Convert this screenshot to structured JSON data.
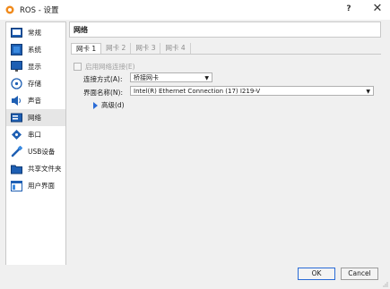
{
  "window": {
    "title": "ROS - 设置",
    "help_label": "?",
    "close_label": "✕"
  },
  "sidebar": {
    "items": [
      {
        "label": "常规",
        "icon": "general-icon"
      },
      {
        "label": "系统",
        "icon": "system-icon"
      },
      {
        "label": "显示",
        "icon": "display-icon"
      },
      {
        "label": "存储",
        "icon": "storage-icon"
      },
      {
        "label": "声音",
        "icon": "audio-icon"
      },
      {
        "label": "网络",
        "icon": "network-icon",
        "active": true
      },
      {
        "label": "串口",
        "icon": "serial-port-icon"
      },
      {
        "label": "USB设备",
        "icon": "usb-icon"
      },
      {
        "label": "共享文件夹",
        "icon": "shared-folder-icon"
      },
      {
        "label": "用户界面",
        "icon": "user-interface-icon"
      }
    ]
  },
  "panel": {
    "title": "网络",
    "tabs": [
      "网卡 1",
      "网卡 2",
      "网卡 3",
      "网卡 4"
    ],
    "enable_label": "启用网络连接(E)",
    "attached_label": "连接方式(A):",
    "attached_value": "桥接网卡",
    "name_label": "界面名称(N):",
    "name_value": "Intel(R) Ethernet Connection (17) I219-V",
    "advanced_label": "高级(d)"
  },
  "buttons": {
    "ok": "OK",
    "cancel": "Cancel"
  },
  "colors": {
    "accent": "#2a6bd6",
    "active_item_bg": "#e6e6e6"
  }
}
